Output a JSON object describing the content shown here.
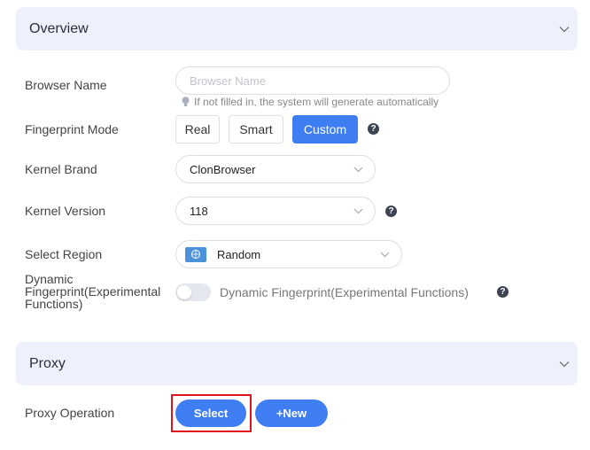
{
  "overview": {
    "title": "Overview"
  },
  "browser_name": {
    "label": "Browser Name",
    "placeholder": "Browser Name",
    "value": "",
    "hint": "If not filled in, the system will generate automatically"
  },
  "fingerprint_mode": {
    "label": "Fingerprint Mode",
    "options": [
      "Real",
      "Smart",
      "Custom"
    ],
    "selected": "Custom"
  },
  "kernel_brand": {
    "label": "Kernel Brand",
    "value": "ClonBrowser"
  },
  "kernel_version": {
    "label": "Kernel Version",
    "value": "118"
  },
  "select_region": {
    "label": "Select Region",
    "value": "Random"
  },
  "dynamic_fingerprint": {
    "label": "Dynamic Fingerprint(Experimental Functions)",
    "toggle_text": "Dynamic Fingerprint(Experimental Functions)",
    "enabled": false
  },
  "proxy": {
    "title": "Proxy"
  },
  "proxy_operation": {
    "label": "Proxy Operation",
    "select_label": "Select",
    "new_label": "+New"
  },
  "colors": {
    "accent": "#3f7df3",
    "header_bg": "#eef1fb",
    "highlight": "#e0121c"
  }
}
